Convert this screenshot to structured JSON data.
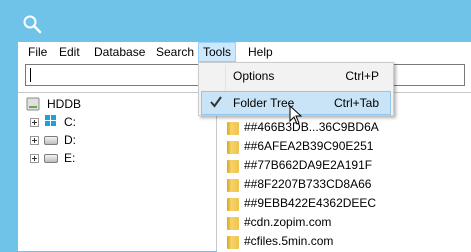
{
  "menubar": {
    "items": [
      "File",
      "Edit",
      "Database",
      "Search",
      "Tools",
      "Help"
    ]
  },
  "search": {
    "value": ""
  },
  "tree": {
    "root_label": "HDDB",
    "drives": [
      "C:",
      "D:",
      "E:"
    ]
  },
  "files": [
    "##466B3DB...36C9BD6A",
    "##6AFEA2B39C90E251",
    "##77B662DA9E2A191F",
    "##8F2207B733CD8A66",
    "##9EBB422E4362DEEC",
    "#cdn.zopim.com",
    "#cfiles.5min.com"
  ],
  "tools_menu": {
    "items": [
      {
        "label": "Options",
        "shortcut": "Ctrl+P",
        "checked": false
      },
      {
        "label": "Folder Tree",
        "shortcut": "Ctrl+Tab",
        "checked": true
      }
    ]
  },
  "colors": {
    "accent": "#6fc3e9",
    "hover": "#cce8ff"
  },
  "icons": [
    "search-icon",
    "drive-icon",
    "folder-icon",
    "checkmark-icon",
    "expand-icon"
  ]
}
